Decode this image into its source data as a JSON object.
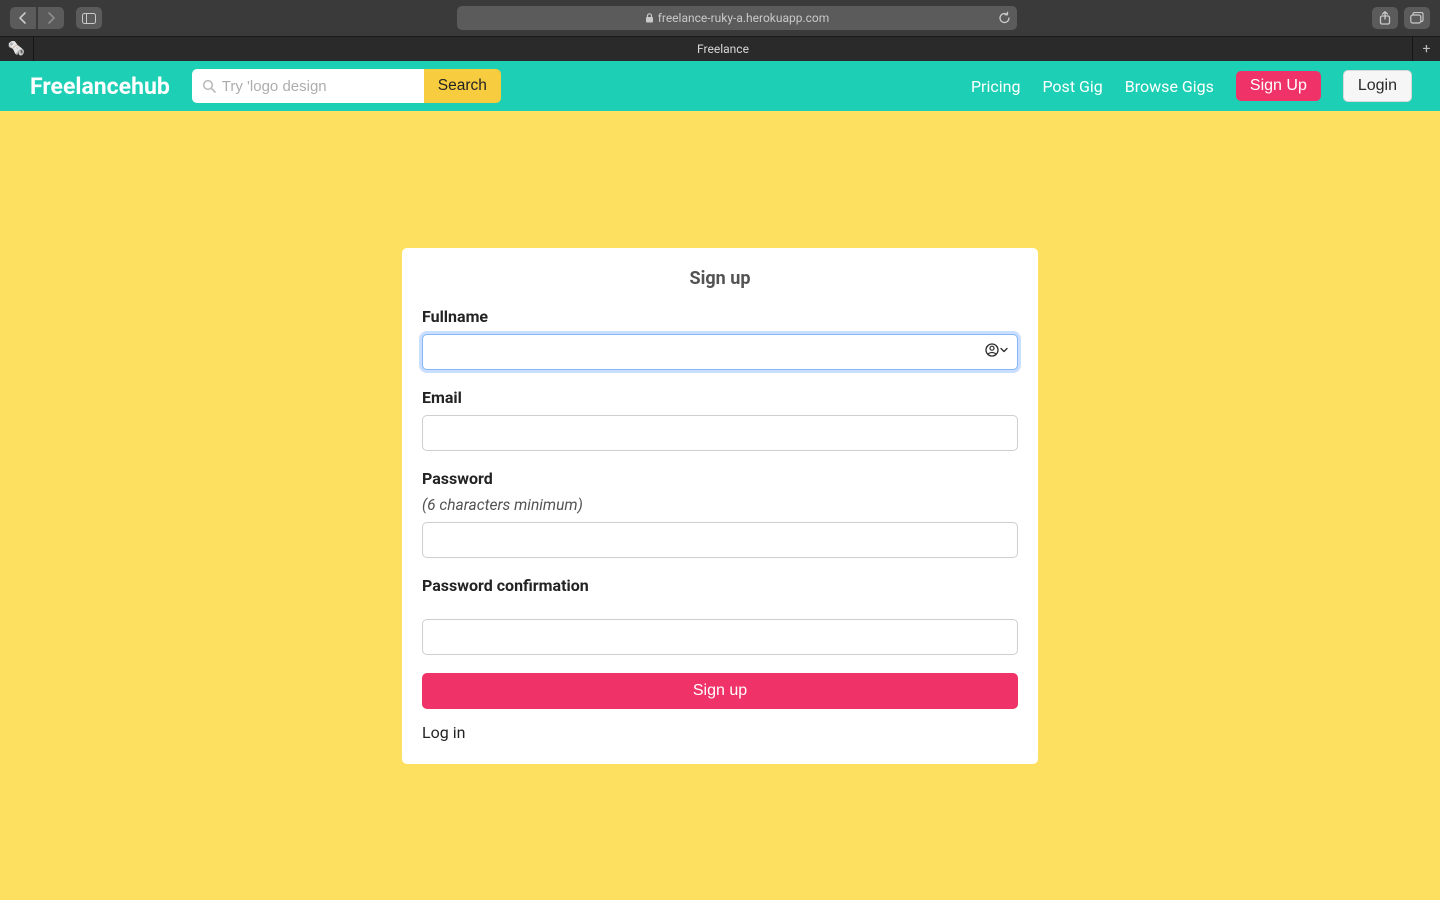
{
  "browser": {
    "url": "freelance-ruky-a.herokuapp.com",
    "tab_title": "Freelance"
  },
  "nav": {
    "brand": "Freelancehub",
    "search_placeholder": "Try 'logo design",
    "search_button": "Search",
    "links": {
      "pricing": "Pricing",
      "post_gig": "Post Gig",
      "browse_gigs": "Browse Gigs"
    },
    "signup_button": "Sign Up",
    "login_button": "Login"
  },
  "form": {
    "title": "Sign up",
    "fullname_label": "Fullname",
    "fullname_value": "",
    "email_label": "Email",
    "email_value": "",
    "password_label": "Password",
    "password_hint": "(6 characters minimum)",
    "password_value": "",
    "password_confirm_label": "Password confirmation",
    "password_confirm_value": "",
    "submit": "Sign up",
    "login_link": "Log in"
  },
  "colors": {
    "accent_teal": "#1dcfb4",
    "accent_pink": "#ef3369",
    "accent_yellow": "#f7cc3f",
    "page_bg": "#fde060"
  }
}
